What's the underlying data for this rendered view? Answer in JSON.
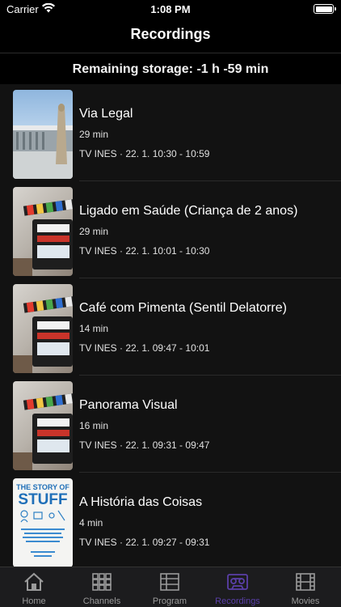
{
  "status_bar": {
    "carrier": "Carrier",
    "time": "1:08 PM"
  },
  "nav": {
    "title": "Recordings"
  },
  "storage": {
    "text": "Remaining storage: -1 h -59 min"
  },
  "recordings": [
    {
      "title": "Via Legal",
      "duration": "29 min",
      "meta": "TV INES · 22. 1. 10:30 - 10:59",
      "thumbnail": "building-photo"
    },
    {
      "title": "Ligado em Saúde (Criança de 2 anos)",
      "duration": "29 min",
      "meta": "TV INES · 22. 1. 10:01 - 10:30",
      "thumbnail": "clapperboard-photo"
    },
    {
      "title": "Café com Pimenta (Sentil Delatorre)",
      "duration": "14 min",
      "meta": "TV INES · 22. 1. 09:47 - 10:01",
      "thumbnail": "clapperboard-photo"
    },
    {
      "title": "Panorama Visual",
      "duration": "16 min",
      "meta": "TV INES · 22. 1. 09:31 - 09:47",
      "thumbnail": "clapperboard-photo"
    },
    {
      "title": "A História das Coisas",
      "duration": "4 min",
      "meta": "TV INES · 22. 1. 09:27 - 09:31",
      "thumbnail": "book-cover"
    }
  ],
  "book_cover": {
    "line1": "THE STORY OF",
    "line2": "STUFF"
  },
  "tabs": [
    {
      "label": "Home",
      "icon": "house-icon",
      "active": false
    },
    {
      "label": "Channels",
      "icon": "grid-icon",
      "active": false
    },
    {
      "label": "Program",
      "icon": "list-icon",
      "active": false
    },
    {
      "label": "Recordings",
      "icon": "cassette-icon",
      "active": true
    },
    {
      "label": "Movies",
      "icon": "film-icon",
      "active": false
    }
  ],
  "colors": {
    "active_tab": "#5a3fa8",
    "background": "#000000",
    "list_background": "#121212"
  }
}
